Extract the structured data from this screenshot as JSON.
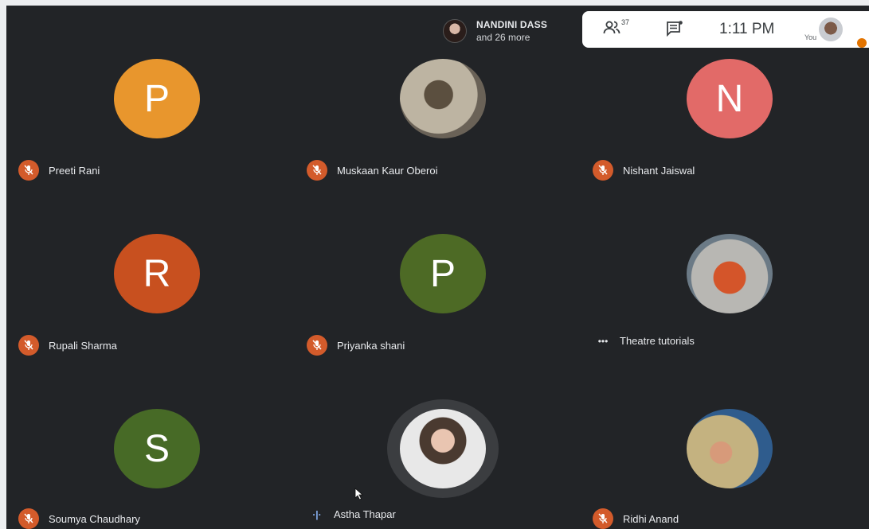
{
  "presenter": {
    "name": "NANDINI DASS",
    "subtitle": "and 26 more"
  },
  "info_bar": {
    "participant_count": "37",
    "time": "1:11 PM",
    "you_label": "You"
  },
  "participants": [
    {
      "name": "Preeti Rani",
      "initial": "P",
      "color": "#e8962d",
      "status": "muted"
    },
    {
      "name": "Muskaan Kaur Oberoi",
      "initial": "",
      "color": "#8a7f6b",
      "status": "muted"
    },
    {
      "name": "Nishant Jaiswal",
      "initial": "N",
      "color": "#e26a68",
      "status": "muted"
    },
    {
      "name": "Rupali Sharma",
      "initial": "R",
      "color": "#c8501f",
      "status": "muted"
    },
    {
      "name": "Priyanka shani",
      "initial": "P",
      "color": "#4d6a25",
      "status": "muted"
    },
    {
      "name": "Theatre tutorials",
      "initial": "",
      "color": "#8c7a6a",
      "status": "more"
    },
    {
      "name": "Soumya Chaudhary",
      "initial": "S",
      "color": "#476a26",
      "status": "muted"
    },
    {
      "name": "Astha Thapar",
      "initial": "",
      "color": "#a9a29c",
      "status": "speaking"
    },
    {
      "name": "Ridhi Anand",
      "initial": "",
      "color": "#c9b37a",
      "status": "muted"
    }
  ],
  "icons": {
    "mic_off": "mic-off-icon",
    "people": "people-icon",
    "chat": "chat-icon"
  }
}
